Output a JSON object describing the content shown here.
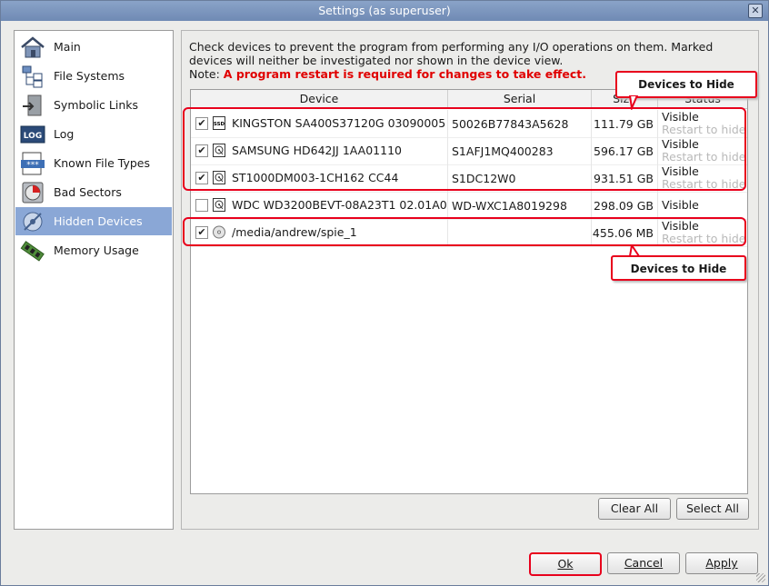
{
  "window": {
    "title": "Settings (as superuser)",
    "close_glyph": "✕"
  },
  "sidebar": {
    "items": [
      {
        "label": "Main",
        "icon": "home-icon"
      },
      {
        "label": "File Systems",
        "icon": "tree-icon"
      },
      {
        "label": "Symbolic Links",
        "icon": "link-door-icon"
      },
      {
        "label": "Log",
        "icon": "log-icon"
      },
      {
        "label": "Known File Types",
        "icon": "file-types-icon"
      },
      {
        "label": "Bad Sectors",
        "icon": "bad-sectors-icon"
      },
      {
        "label": "Hidden Devices",
        "icon": "hidden-devices-icon",
        "active": true
      },
      {
        "label": "Memory Usage",
        "icon": "memory-icon"
      }
    ]
  },
  "content": {
    "intro": "Check devices to prevent the program from performing any I/O operations on them. Marked devices will neither be investigated nor shown in the device view.",
    "note_label": "Note:",
    "note_text": "A program restart is required for changes to take effect.",
    "table": {
      "columns": [
        "Device",
        "Serial",
        "Size",
        "Status"
      ],
      "rows": [
        {
          "checked": true,
          "icon": "ssd-icon",
          "device": "KINGSTON SA400S37120G 03090005",
          "serial": "50026B77843A5628",
          "size": "111.79 GB",
          "status": "Visible",
          "status_sub": "Restart to hide"
        },
        {
          "checked": true,
          "icon": "hdd-icon",
          "device": "SAMSUNG HD642JJ 1AA01110",
          "serial": "S1AFJ1MQ400283",
          "size": "596.17 GB",
          "status": "Visible",
          "status_sub": "Restart to hide"
        },
        {
          "checked": true,
          "icon": "hdd-icon",
          "device": "ST1000DM003-1CH162 CC44",
          "serial": "S1DC12W0",
          "size": "931.51 GB",
          "status": "Visible",
          "status_sub": "Restart to hide"
        },
        {
          "checked": false,
          "icon": "hdd-icon",
          "device": "WDC WD3200BEVT-08A23T1 02.01A02",
          "serial": "WD-WXC1A8019298",
          "size": "298.09 GB",
          "status": "Visible",
          "status_sub": ""
        },
        {
          "checked": true,
          "icon": "disc-image-icon",
          "device": "/media/andrew/spie_1",
          "serial": "",
          "size": "455.06 MB",
          "status": "Visible",
          "status_sub": "Restart to hide"
        }
      ]
    },
    "clear_all": "Clear All",
    "select_all": "Select All"
  },
  "footer": {
    "ok": "Ok",
    "cancel": "Cancel",
    "apply": "Apply"
  },
  "annotations": {
    "callout_top": "Devices to Hide",
    "callout_bottom": "Devices to Hide"
  },
  "colors": {
    "highlight": "#e8001c",
    "active_nav": "#8aa7d6",
    "note_red": "#e00000"
  }
}
